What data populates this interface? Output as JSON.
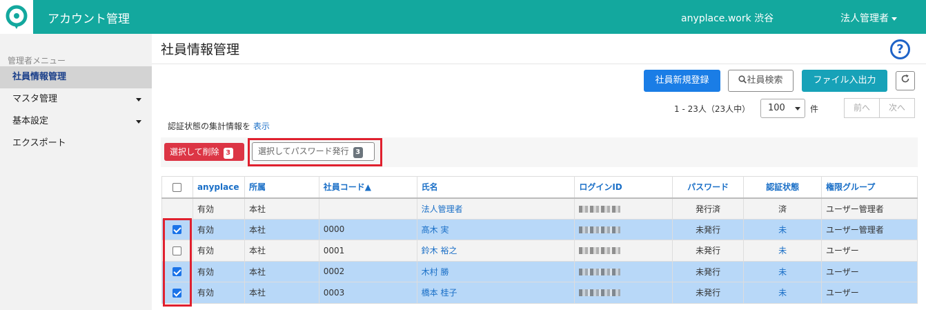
{
  "header": {
    "app_title": "アカウント管理",
    "workspace": "anyplace.work 渋谷",
    "user_role": "法人管理者",
    "brand_color": "#13a89e"
  },
  "sidebar": {
    "caption": "管理者メニュー",
    "items": [
      {
        "label": "社員情報管理",
        "active": true
      },
      {
        "label": "マスタ管理",
        "has_submenu": true
      },
      {
        "label": "基本設定",
        "has_submenu": true
      },
      {
        "label": "エクスポート"
      }
    ]
  },
  "main": {
    "title": "社員情報管理",
    "help_label": "?",
    "toolbar": {
      "new_employee": "社員新規登録",
      "search": "社員検索",
      "file_io": "ファイル入出力"
    },
    "pagination": {
      "count_text": "1 - 23人（23人中）",
      "page_size": "100",
      "unit": "件",
      "prev": "前へ",
      "next": "次へ"
    },
    "summary": {
      "text": "認証状態の集計情報を",
      "link": "表示"
    },
    "bulk": {
      "delete_label": "選択して削除",
      "delete_count": "3",
      "password_label": "選択してパスワード発行",
      "password_count": "3"
    }
  },
  "table": {
    "headers": [
      "anyplace",
      "所属",
      "社員コード▲",
      "氏名",
      "ログインID",
      "パスワード",
      "認証状態",
      "権限グループ"
    ],
    "rows": [
      {
        "status": "有効",
        "dept": "本社",
        "code": "",
        "name": "法人管理者",
        "password": "発行済",
        "auth": "済",
        "group": "ユーザー管理者",
        "checked": null
      },
      {
        "status": "有効",
        "dept": "本社",
        "code": "0000",
        "name": "髙木 実",
        "password": "未発行",
        "auth": "未",
        "group": "ユーザー管理者",
        "checked": true
      },
      {
        "status": "有効",
        "dept": "本社",
        "code": "0001",
        "name": "鈴木 裕之",
        "password": "未発行",
        "auth": "未",
        "group": "ユーザー",
        "checked": false
      },
      {
        "status": "有効",
        "dept": "本社",
        "code": "0002",
        "name": "木村 勝",
        "password": "未発行",
        "auth": "未",
        "group": "ユーザー",
        "checked": true
      },
      {
        "status": "有効",
        "dept": "本社",
        "code": "0003",
        "name": "橋本 桂子",
        "password": "未発行",
        "auth": "未",
        "group": "ユーザー",
        "checked": true
      }
    ]
  }
}
